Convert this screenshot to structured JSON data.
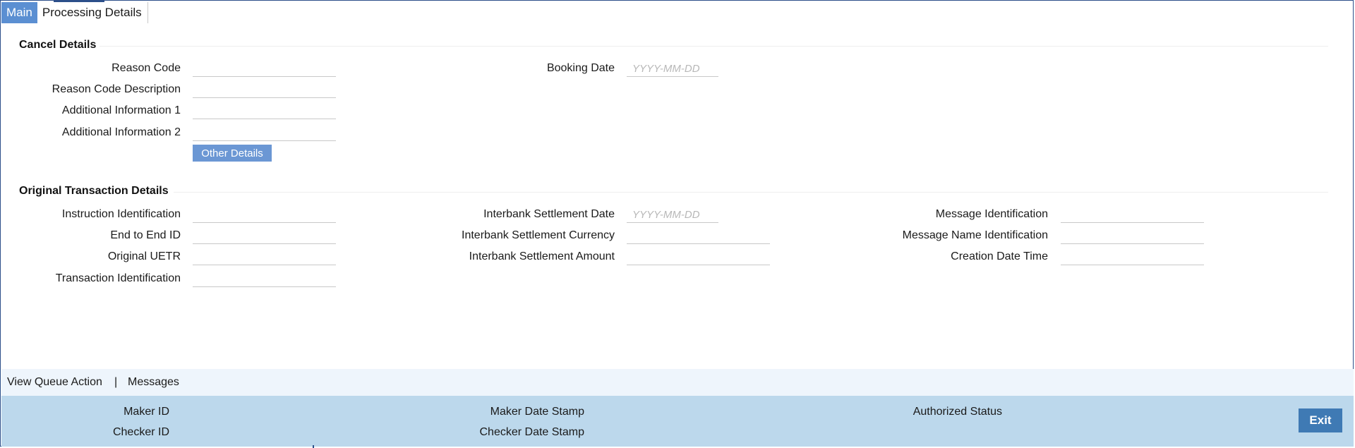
{
  "tabs": [
    {
      "label": "Main",
      "active": true
    },
    {
      "label": "Processing Details",
      "active": false
    }
  ],
  "cancel_details": {
    "title": "Cancel Details",
    "reason_code": {
      "label": "Reason Code",
      "value": ""
    },
    "reason_code_description": {
      "label": "Reason Code Description",
      "value": ""
    },
    "additional_information_1": {
      "label": "Additional Information 1",
      "value": ""
    },
    "additional_information_2": {
      "label": "Additional Information 2",
      "value": ""
    },
    "booking_date": {
      "label": "Booking Date",
      "value": "",
      "placeholder": "YYYY-MM-DD"
    },
    "other_details_label": "Other Details"
  },
  "original_transaction": {
    "title": "Original Transaction Details",
    "instruction_identification": {
      "label": "Instruction Identification",
      "value": ""
    },
    "end_to_end_id": {
      "label": "End to End ID",
      "value": ""
    },
    "original_uetr": {
      "label": "Original UETR",
      "value": ""
    },
    "transaction_identification": {
      "label": "Transaction Identification",
      "value": ""
    },
    "interbank_settlement_date": {
      "label": "Interbank Settlement Date",
      "value": "",
      "placeholder": "YYYY-MM-DD"
    },
    "interbank_settlement_currency": {
      "label": "Interbank Settlement Currency",
      "value": ""
    },
    "interbank_settlement_amount": {
      "label": "Interbank Settlement Amount",
      "value": ""
    },
    "message_identification": {
      "label": "Message Identification",
      "value": ""
    },
    "message_name_identification": {
      "label": "Message Name Identification",
      "value": ""
    },
    "creation_date_time": {
      "label": "Creation Date Time",
      "value": ""
    }
  },
  "links": {
    "view_queue_action": "View Queue Action",
    "separator": "|",
    "messages": "Messages"
  },
  "audit": {
    "maker_id": "Maker ID",
    "checker_id": "Checker ID",
    "maker_date_stamp": "Maker Date Stamp",
    "checker_date_stamp": "Checker Date Stamp",
    "authorized_status": "Authorized Status",
    "exit_label": "Exit"
  },
  "colors": {
    "active_tab": "#5b8fd2",
    "button": "#6b97d4",
    "exit_button": "#3f7ab4",
    "links_bar": "#eef5fc",
    "audit_bar": "#bcd8ec",
    "frame_border": "#2c4f8a"
  }
}
